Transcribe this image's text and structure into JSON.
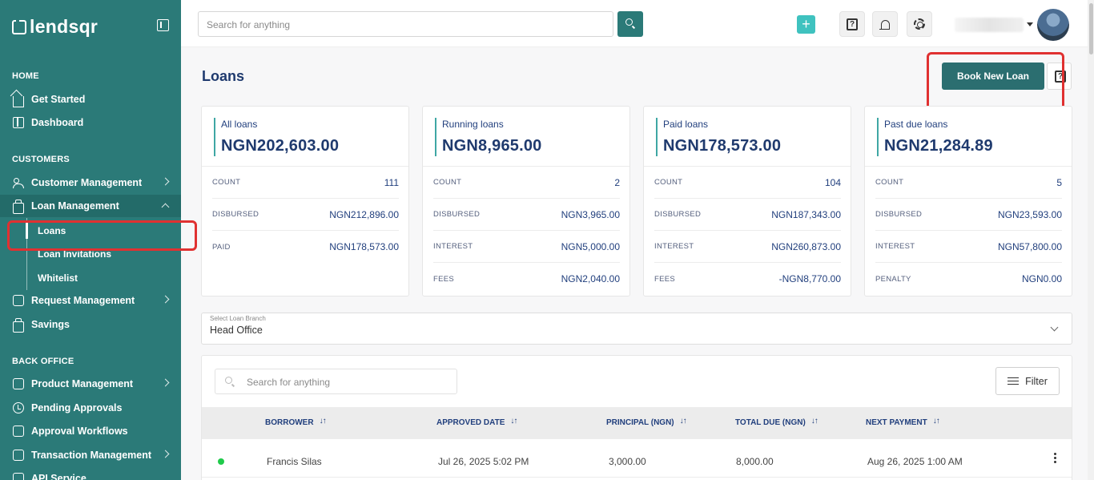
{
  "brand": {
    "name": "lendsqr"
  },
  "sidebar": {
    "sections": {
      "home": "HOME",
      "customers": "CUSTOMERS",
      "back_office": "BACK OFFICE"
    },
    "items": {
      "get_started": "Get Started",
      "dashboard": "Dashboard",
      "customer_management": "Customer Management",
      "loan_management": "Loan Management",
      "request_management": "Request Management",
      "savings": "Savings",
      "product_management": "Product Management",
      "pending_approvals": "Pending Approvals",
      "approval_workflows": "Approval Workflows",
      "transaction_management": "Transaction Management",
      "api_service": "API Service"
    },
    "loan_sub": {
      "loans": "Loans",
      "loan_invitations": "Loan Invitations",
      "whitelist": "Whitelist"
    }
  },
  "topbar": {
    "search_placeholder": "Search for anything",
    "plus_label": "+"
  },
  "page": {
    "title": "Loans",
    "book_new_loan": "Book New Loan"
  },
  "cards": [
    {
      "label": "All loans",
      "amount": "NGN202,603.00",
      "rows": [
        {
          "k": "COUNT",
          "v": "111"
        },
        {
          "k": "DISBURSED",
          "v": "NGN212,896.00"
        },
        {
          "k": "PAID",
          "v": "NGN178,573.00"
        }
      ]
    },
    {
      "label": "Running loans",
      "amount": "NGN8,965.00",
      "rows": [
        {
          "k": "COUNT",
          "v": "2"
        },
        {
          "k": "DISBURSED",
          "v": "NGN3,965.00"
        },
        {
          "k": "INTEREST",
          "v": "NGN5,000.00"
        },
        {
          "k": "FEES",
          "v": "NGN2,040.00"
        }
      ]
    },
    {
      "label": "Paid loans",
      "amount": "NGN178,573.00",
      "rows": [
        {
          "k": "COUNT",
          "v": "104"
        },
        {
          "k": "DISBURSED",
          "v": "NGN187,343.00"
        },
        {
          "k": "INTEREST",
          "v": "NGN260,873.00"
        },
        {
          "k": "FEES",
          "v": "-NGN8,770.00"
        }
      ]
    },
    {
      "label": "Past due loans",
      "amount": "NGN21,284.89",
      "rows": [
        {
          "k": "COUNT",
          "v": "5"
        },
        {
          "k": "DISBURSED",
          "v": "NGN23,593.00"
        },
        {
          "k": "INTEREST",
          "v": "NGN57,800.00"
        },
        {
          "k": "PENALTY",
          "v": "NGN0.00"
        }
      ]
    }
  ],
  "branch": {
    "label": "Select Loan Branch",
    "value": "Head Office"
  },
  "table": {
    "search_placeholder": "Search for anything",
    "filter_label": "Filter",
    "columns": [
      "BORROWER",
      "APPROVED DATE",
      "PRINCIPAL (NGN)",
      "TOTAL DUE (NGN)",
      "NEXT PAYMENT"
    ],
    "rows": [
      {
        "status_color": "#1fca4a",
        "borrower": "Francis Silas",
        "approved_date": "Jul 26, 2025 5:02 PM",
        "principal": "3,000.00",
        "total_due": "8,000.00",
        "next_payment": "Aug 26, 2025 1:00 AM"
      }
    ]
  },
  "colors": {
    "sidebar_bg": "#2b7a78",
    "primary_button": "#2b6e70",
    "accent": "#3fc2bf",
    "highlight_outline": "#e03131"
  }
}
